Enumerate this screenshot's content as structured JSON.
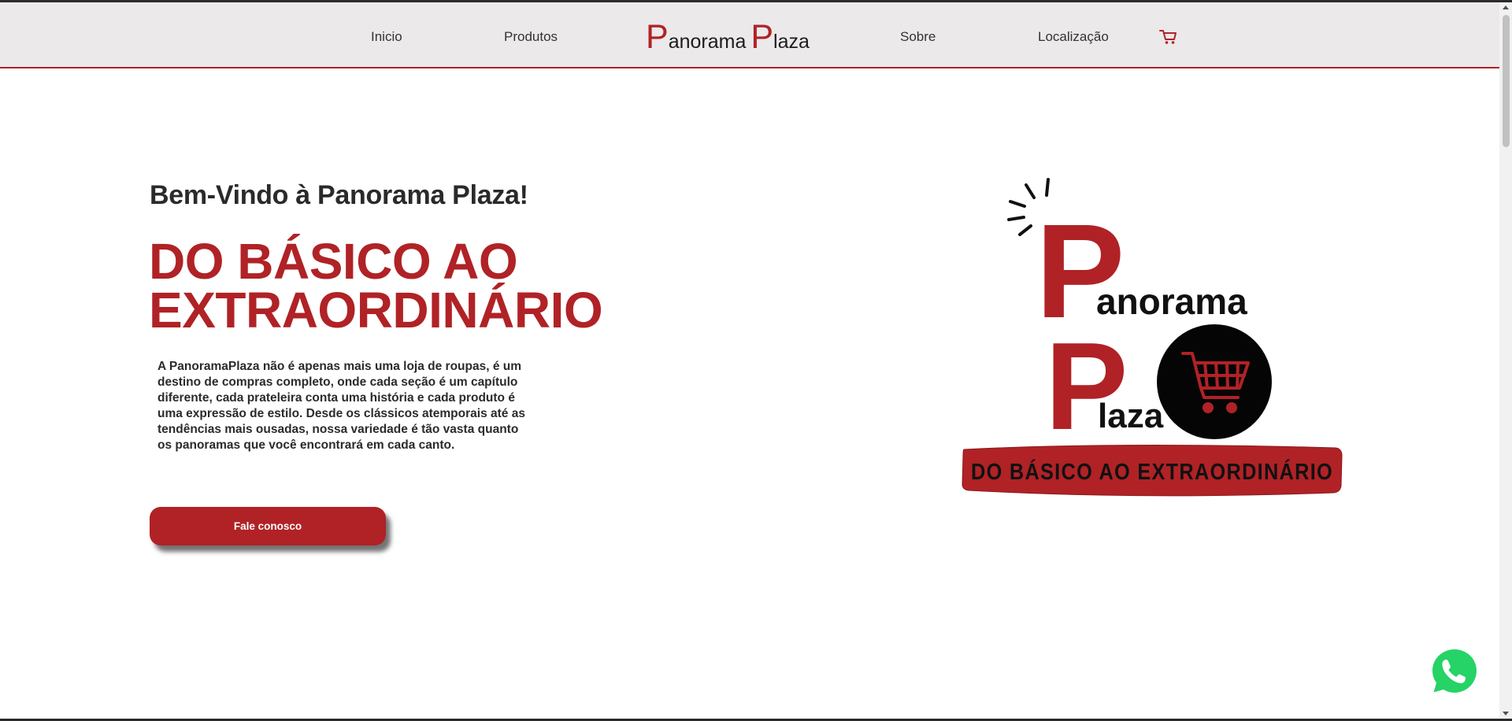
{
  "nav": {
    "links": [
      "Inicio",
      "Produtos",
      "Sobre",
      "Localização"
    ],
    "brand": {
      "first_cap": "P",
      "first_rest": "anorama",
      "second_cap": "P",
      "second_rest": "laza"
    },
    "cart_icon": "cart-icon"
  },
  "hero": {
    "welcome": "Bem-Vindo à Panorama Plaza!",
    "headline": "DO BÁSICO AO EXTRAORDINÁRIO",
    "description": "A PanoramaPlaza não é apenas mais uma loja de roupas, é um destino de compras completo, onde cada seção é um capítulo diferente, cada prateleira conta uma história e cada produto é uma expressão de estilo. Desde os clássicos atemporais até as tendências mais ousadas, nossa variedade é tão vasta quanto os panoramas que você encontrará em cada canto.",
    "cta_label": "Fale conosco"
  },
  "logo": {
    "cap1": "P",
    "word1": "anorama",
    "cap2": "P",
    "word2": "laza",
    "banner": "DO BÁSICO AO EXTRAORDINÁRIO"
  },
  "floating": {
    "whatsapp_icon": "whatsapp-icon"
  },
  "colors": {
    "accent": "#b02226",
    "header_bg": "#ebe9ea",
    "text": "#2a2a2a",
    "whatsapp": "#25d366"
  }
}
